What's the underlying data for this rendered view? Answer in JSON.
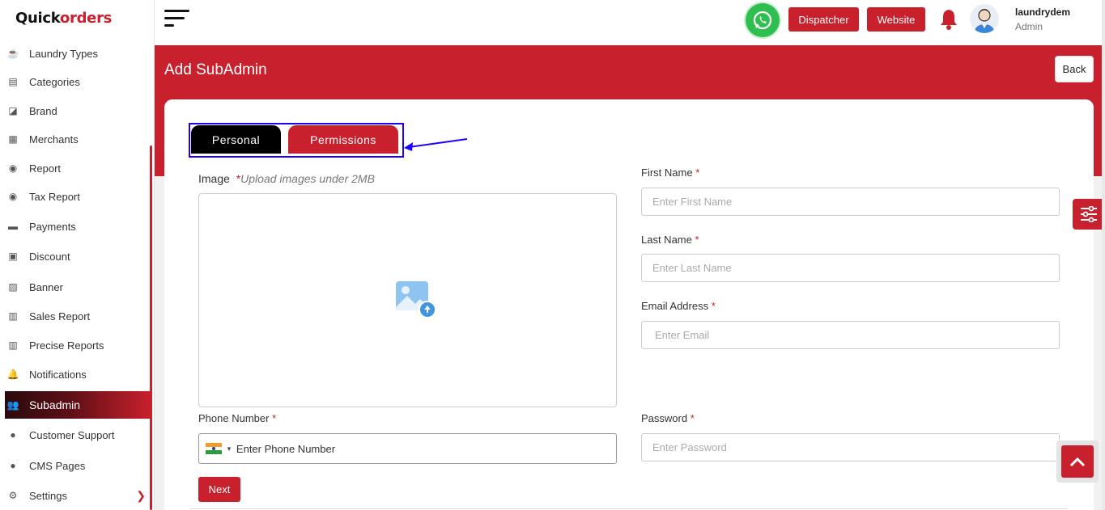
{
  "brand": {
    "part1": "Quick",
    "part2": "orders",
    "accent": "#c8202c"
  },
  "sidebar": {
    "items": [
      {
        "label": "Laundry Types",
        "icon": "cup-icon"
      },
      {
        "label": "Categories",
        "icon": "document-icon"
      },
      {
        "label": "Brand",
        "icon": "brand-icon"
      },
      {
        "label": "Merchants",
        "icon": "store-icon"
      },
      {
        "label": "Report",
        "icon": "report-icon"
      },
      {
        "label": "Tax Report",
        "icon": "tax-report-icon"
      },
      {
        "label": "Payments",
        "icon": "payments-icon"
      },
      {
        "label": "Discount",
        "icon": "discount-icon"
      },
      {
        "label": "Banner",
        "icon": "image-icon"
      },
      {
        "label": "Sales Report",
        "icon": "chart-icon"
      },
      {
        "label": "Precise Reports",
        "icon": "chart-icon"
      },
      {
        "label": "Notifications",
        "icon": "bell-icon"
      },
      {
        "label": "Subadmin",
        "icon": "users-icon",
        "active": true
      },
      {
        "label": "Customer Support",
        "icon": "help-icon"
      },
      {
        "label": "CMS Pages",
        "icon": "chat-icon"
      },
      {
        "label": "Settings",
        "icon": "gear-icon"
      }
    ]
  },
  "topbar": {
    "dispatcher_label": "Dispatcher",
    "website_label": "Website",
    "user_name": "laundrydem",
    "user_role": "Admin"
  },
  "page": {
    "title": "Add SubAdmin",
    "back_label": "Back"
  },
  "tabs": [
    {
      "label": "Personal",
      "active": true
    },
    {
      "label": "Permissions",
      "active": false
    }
  ],
  "form": {
    "image_label": "Image",
    "image_required": "*",
    "image_hint": "Upload images under 2MB",
    "first_name_label": "First Name",
    "first_name_placeholder": "Enter First Name",
    "last_name_label": "Last Name",
    "last_name_placeholder": "Enter Last Name",
    "email_label": "Email Address",
    "email_placeholder": "Enter Email",
    "phone_label": "Phone Number",
    "phone_placeholder": "Enter Phone Number",
    "password_label": "Password",
    "password_placeholder": "Enter  Password",
    "required_mark": "*",
    "next_label": "Next"
  }
}
